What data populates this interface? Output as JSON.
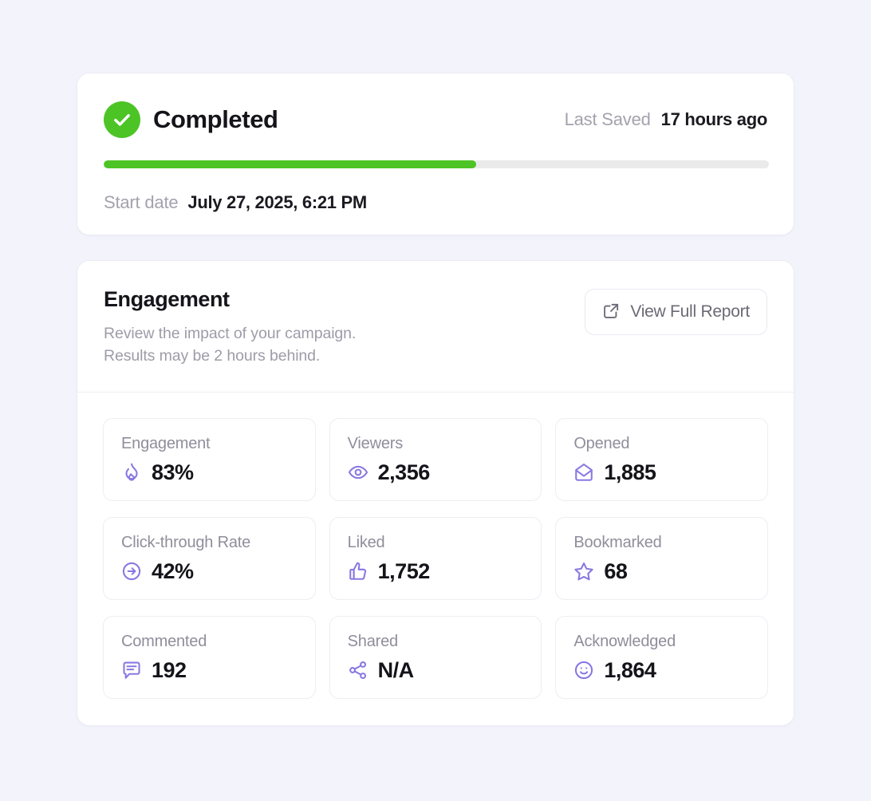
{
  "theme": {
    "page_background": "#F3F3FC",
    "card_background": "#FFFFFF",
    "accent_green": "#4CC425",
    "accent_purple": "#8878E2",
    "text_primary": "#15141A",
    "text_muted": "#9D9CA8"
  },
  "status_card": {
    "icon": "check-circle-icon",
    "title": "Completed",
    "last_saved_label": "Last Saved",
    "last_saved_value": "17 hours ago",
    "progress_percent": 56,
    "start_date_label": "Start date",
    "start_date_value": "July 27, 2025, 6:21 PM"
  },
  "engagement_card": {
    "title": "Engagement",
    "subtitle": "Review the impact of your campaign.\nResults may be 2 hours behind.",
    "report_button": {
      "label": "View Full Report",
      "icon": "external-link-icon"
    },
    "metrics": [
      {
        "label": "Engagement",
        "value": "83%",
        "icon": "flame-icon"
      },
      {
        "label": "Viewers",
        "value": "2,356",
        "icon": "eye-icon"
      },
      {
        "label": "Opened",
        "value": "1,885",
        "icon": "envelope-open-icon"
      },
      {
        "label": "Click-through Rate",
        "value": "42%",
        "icon": "arrow-right-circle-icon"
      },
      {
        "label": "Liked",
        "value": "1,752",
        "icon": "thumbs-up-icon"
      },
      {
        "label": "Bookmarked",
        "value": "68",
        "icon": "star-icon"
      },
      {
        "label": "Commented",
        "value": "192",
        "icon": "comment-icon"
      },
      {
        "label": "Shared",
        "value": "N/A",
        "icon": "share-icon"
      },
      {
        "label": "Acknowledged",
        "value": "1,864",
        "icon": "smiley-icon"
      }
    ]
  }
}
